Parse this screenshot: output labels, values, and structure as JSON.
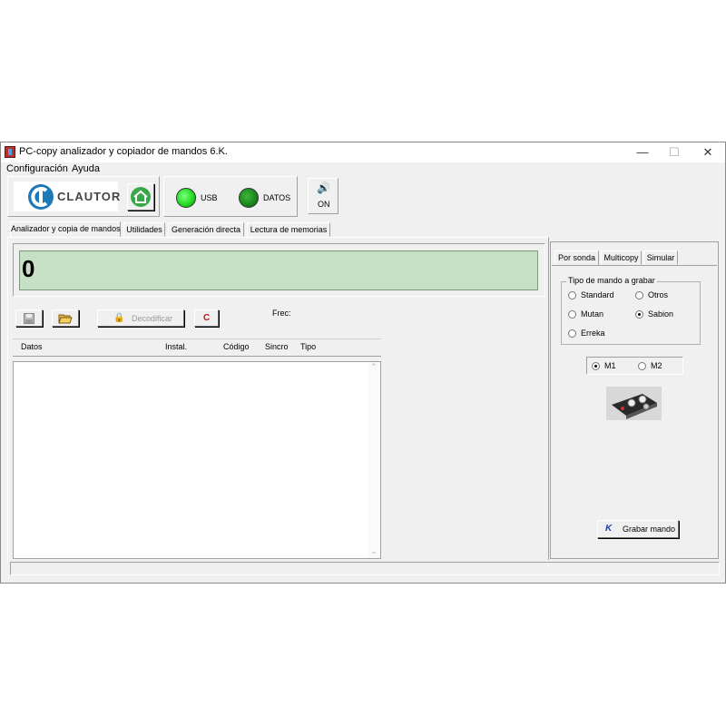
{
  "window": {
    "title": "PC-copy analizador y copiador de mandos 6.K.",
    "minimize": "—",
    "maximize": "☐",
    "close": "✕"
  },
  "menu": {
    "items": [
      "Configuración",
      "Ayuda"
    ]
  },
  "toolbar": {
    "logo_text": "CLAUTOR",
    "usb_label": "USB",
    "datos_label": "DATOS",
    "sound_label": "ON"
  },
  "tabs": [
    "Analizador y copia de mandos",
    "Utilidades",
    "Generación directa",
    "Lectura de memorias"
  ],
  "display": {
    "value": "0"
  },
  "actions": {
    "decode_label": "Decodificar",
    "clear_label": "C",
    "freq_label": "Frec:"
  },
  "table": {
    "columns": [
      "Datos",
      "Instal.",
      "Código",
      "Sincro",
      "Tipo"
    ],
    "rows": []
  },
  "right_panel": {
    "tabs": [
      "Por sonda",
      "Multicopy",
      "Simular"
    ],
    "group_title": "Tipo de mando a grabar",
    "options": [
      {
        "label": "Standard",
        "selected": false
      },
      {
        "label": "Otros",
        "selected": false
      },
      {
        "label": "Mutan",
        "selected": false
      },
      {
        "label": "Sabion",
        "selected": true
      },
      {
        "label": "Erreka",
        "selected": false
      }
    ],
    "memory": [
      {
        "label": "M1",
        "selected": true
      },
      {
        "label": "M2",
        "selected": false
      }
    ],
    "record_button": "Grabar mando"
  },
  "colors": {
    "display_bg": "#c5e0c5",
    "led_usb": "#22dd22",
    "led_datos": "#1d8a1d",
    "brand_blue": "#1f79b6"
  }
}
